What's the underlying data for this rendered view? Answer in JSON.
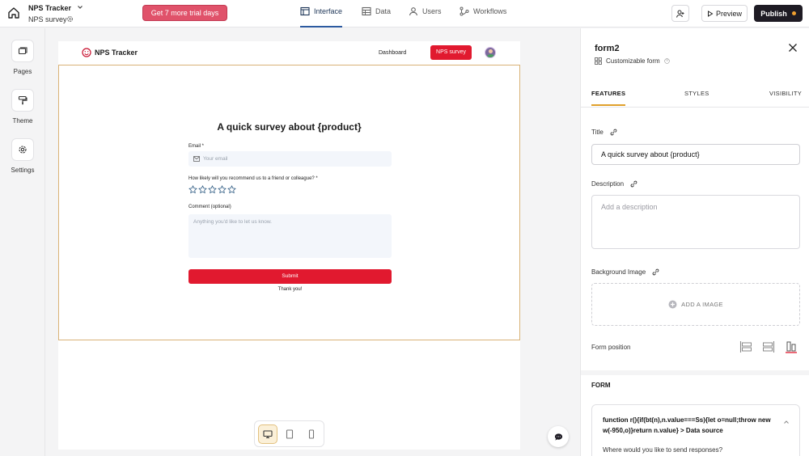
{
  "app": {
    "name": "NPS Tracker",
    "page": "NPS survey",
    "trial_label": "Get 7 more trial days"
  },
  "nav": {
    "tabs": [
      {
        "label": "Interface",
        "icon": "layout-icon",
        "active": true
      },
      {
        "label": "Data",
        "icon": "table-icon",
        "active": false
      },
      {
        "label": "Users",
        "icon": "user-icon",
        "active": false
      },
      {
        "label": "Workflows",
        "icon": "workflow-icon",
        "active": false
      }
    ],
    "preview_label": "Preview",
    "publish_label": "Publish"
  },
  "rail": {
    "items": [
      {
        "label": "Pages",
        "icon": "pages-icon"
      },
      {
        "label": "Theme",
        "icon": "paint-roller-icon"
      },
      {
        "label": "Settings",
        "icon": "gear-icon"
      }
    ]
  },
  "canvas": {
    "brand": "NPS Tracker",
    "links": {
      "dashboard": "Dashboard",
      "nps_survey": "NPS survey"
    },
    "form": {
      "title": "A quick survey about {product}",
      "email_label": "Email *",
      "email_placeholder": "Your email",
      "rating_label": "How likely will you recommend us to a friend or colleague? *",
      "rating_stars": 5,
      "rating_value": 0,
      "comment_label": "Comment (optional)",
      "comment_placeholder": "Anything you'd like to let us know.",
      "submit_label": "Submit",
      "thanks": "Thank you!"
    },
    "devices": {
      "active": "desktop",
      "options": [
        "desktop",
        "tablet",
        "mobile"
      ]
    }
  },
  "panel": {
    "title": "form2",
    "subtitle": "Customizable form",
    "tabs": [
      "FEATURES",
      "STYLES",
      "VISIBILITY"
    ],
    "active_tab": "FEATURES",
    "title_label": "Title",
    "title_value": "A quick survey about {product}",
    "description_label": "Description",
    "description_placeholder": "Add a description",
    "bg_image_label": "Background Image",
    "add_image_label": "ADD A IMAGE",
    "form_position_label": "Form position",
    "form_position_value": "right",
    "form_section": "FORM",
    "code_text": "function r(){if(bt(n),n.value===Ss){let o=null;throw new w(-950,o)}return n.value} > Data source",
    "where_label": "Where would you like to send responses?"
  },
  "colors": {
    "accent_red": "#e1192f",
    "trial_pink": "#e0526a",
    "publish_dark": "#1e1b24",
    "tab_underline": "#e0a02b",
    "frame_border": "#d9b277"
  }
}
